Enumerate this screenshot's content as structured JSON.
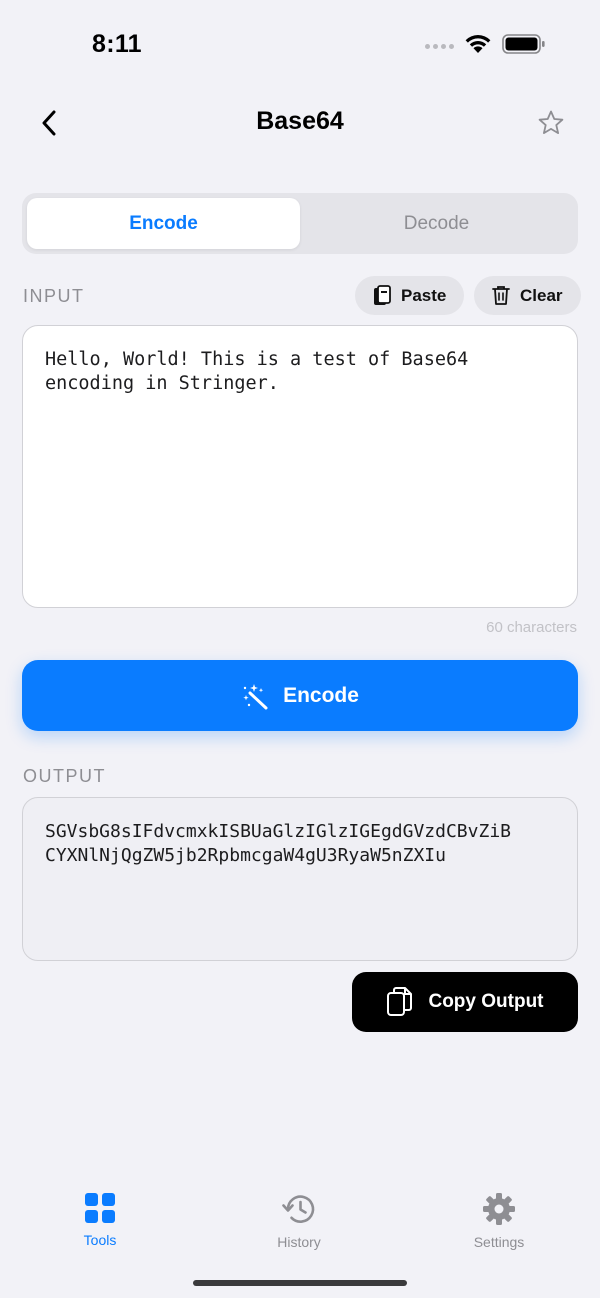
{
  "status_bar": {
    "time": "8:11"
  },
  "nav": {
    "title": "Base64"
  },
  "mode": {
    "options": [
      "Encode",
      "Decode"
    ],
    "selected": "Encode"
  },
  "input": {
    "label": "INPUT",
    "paste_label": "Paste",
    "clear_label": "Clear",
    "value": "Hello, World! This is a test of Base64\nencoding in Stringer.",
    "char_count": "60 characters"
  },
  "action": {
    "label": "Encode"
  },
  "output": {
    "label": "OUTPUT",
    "value": "SGVsbG8sIFdvcmxkISBUaGlzIGlzIGEgdGVzdCBvZiB\nCYXNlNjQgZW5jb2RpbmcgaW4gU3RyaW5nZXIu",
    "copy_label": "Copy Output"
  },
  "tab_bar": {
    "items": [
      {
        "label": "Tools",
        "icon": "grid-icon",
        "active": true
      },
      {
        "label": "History",
        "icon": "history-icon",
        "active": false
      },
      {
        "label": "Settings",
        "icon": "gear-icon",
        "active": false
      }
    ]
  },
  "colors": {
    "accent": "#0a7cff",
    "background": "#f2f2f7",
    "inactive": "#8e8e93"
  }
}
